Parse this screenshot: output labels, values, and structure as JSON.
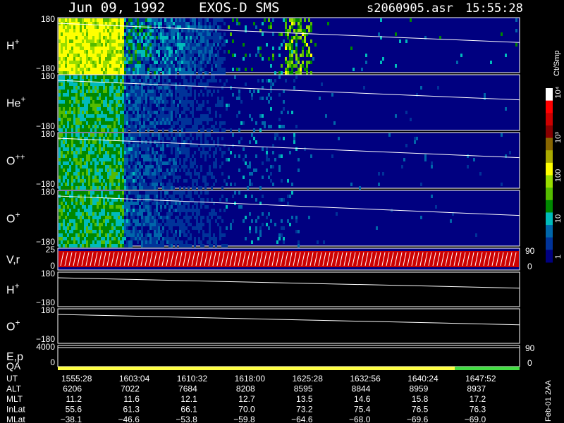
{
  "header": {
    "date": "Jun 09, 1992",
    "mission": "EXOS-D SMS",
    "file": "s2060905.asr",
    "time": "15:55:28"
  },
  "colorbar": {
    "unit": "Ct/Smp",
    "tick_labels": [
      "10⁴",
      "10³",
      "100",
      "10",
      "1"
    ],
    "colors": [
      "#ffffff",
      "#ff0000",
      "#cc0000",
      "#880000",
      "#886600",
      "#aaaa00",
      "#ffff00",
      "#99dd00",
      "#55bb00",
      "#008800",
      "#00bbbb",
      "#0066aa",
      "#003399",
      "#000080"
    ]
  },
  "chart_data": {
    "type": "heatmap",
    "panels": [
      {
        "label": "H",
        "charge": "+",
        "ytop": "180",
        "ybot": "−180",
        "kind": "spectrogram",
        "activity": 1.0
      },
      {
        "label": "He",
        "charge": "+",
        "ytop": "180",
        "ybot": "−180",
        "kind": "spectrogram",
        "activity": 0.55
      },
      {
        "label": "O",
        "charge": "++",
        "ytop": "180",
        "ybot": "−180",
        "kind": "spectrogram",
        "activity": 0.5
      },
      {
        "label": "O",
        "charge": "+",
        "ytop": "180",
        "ybot": "−180",
        "kind": "spectrogram",
        "activity": 0.6
      },
      {
        "label": "V,r",
        "charge": "",
        "ytop": "25",
        "ybot": "0",
        "right_top": "90",
        "right_bot": "0",
        "kind": "velocity"
      },
      {
        "label": "H",
        "charge": "+",
        "ytop": "180",
        "ybot": "−180",
        "kind": "line"
      },
      {
        "label": "O",
        "charge": "+",
        "ytop": "180",
        "ybot": "−180",
        "kind": "line"
      },
      {
        "label": "E,p",
        "label2": "QA",
        "charge": "",
        "ytop": "4000",
        "ybot": "0",
        "right_top": "90",
        "right_bot": "0",
        "kind": "quality"
      }
    ],
    "time_axis": {
      "labels": [
        "1555:28",
        "1603:04",
        "1610:32",
        "1618:00",
        "1625:28",
        "1632:56",
        "1640:24",
        "1647:52"
      ]
    },
    "ephemeris": [
      {
        "name": "UT",
        "values": [
          "1555:28",
          "1603:04",
          "1610:32",
          "1618:00",
          "1625:28",
          "1632:56",
          "1640:24",
          "1647:52"
        ]
      },
      {
        "name": "ALT",
        "values": [
          "6206",
          "7022",
          "7684",
          "8208",
          "8595",
          "8844",
          "8959",
          "8937"
        ]
      },
      {
        "name": "MLT",
        "values": [
          "11.2",
          "11.6",
          "12.1",
          "12.7",
          "13.5",
          "14.6",
          "15.8",
          "17.2"
        ]
      },
      {
        "name": "InLat",
        "values": [
          "55.6",
          "61.3",
          "66.1",
          "70.0",
          "73.2",
          "75.4",
          "76.5",
          "76.3"
        ]
      },
      {
        "name": "MLat",
        "values": [
          "−38.1",
          "−46.6",
          "−53.8",
          "−59.8",
          "−64.6",
          "−68.0",
          "−69.6",
          "−69.0"
        ]
      }
    ]
  },
  "footer": {
    "stamp": "Feb-01 2AA"
  }
}
